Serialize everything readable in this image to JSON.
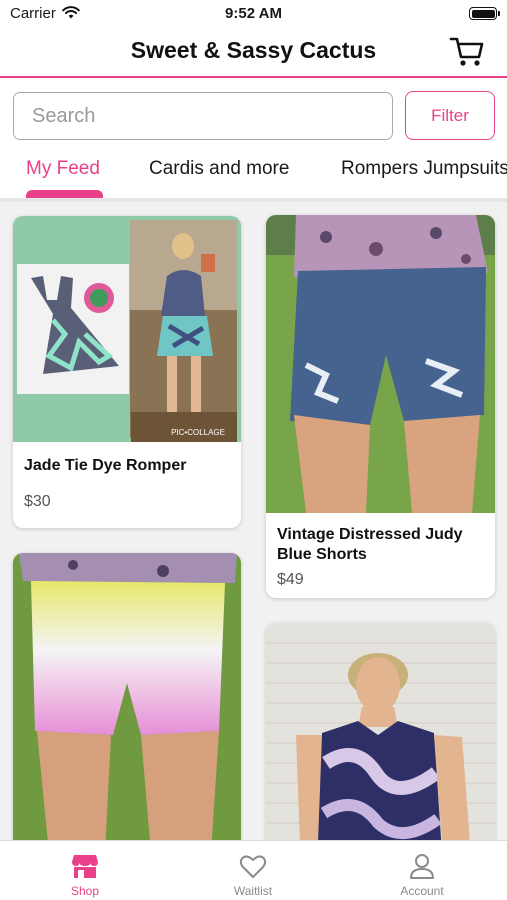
{
  "status_bar": {
    "carrier": "Carrier",
    "time": "9:52 AM"
  },
  "header": {
    "title": "Sweet & Sassy Cactus",
    "cart_icon": "cart-icon"
  },
  "search": {
    "placeholder": "Search",
    "value": ""
  },
  "filter_label": "Filter",
  "tabs": [
    {
      "label": "My Feed",
      "active": true
    },
    {
      "label": "Cardis and more",
      "active": false
    },
    {
      "label": "Rompers Jumpsuits",
      "active": false
    }
  ],
  "products": [
    {
      "title": "Jade Tie Dye Romper",
      "price": "$30",
      "image_watermark": "PIC•COLLAGE"
    },
    {
      "title": "Vintage Distressed Judy Blue Shorts",
      "price": "$49"
    },
    {
      "title": "",
      "price": ""
    },
    {
      "title": "",
      "price": ""
    }
  ],
  "bottom_nav": [
    {
      "label": "Shop",
      "icon": "shop-icon",
      "active": true
    },
    {
      "label": "Waitlist",
      "icon": "heart-icon",
      "active": false
    },
    {
      "label": "Account",
      "icon": "person-icon",
      "active": false
    }
  ],
  "colors": {
    "accent": "#e8418a",
    "tab_divider": "#e5e5e5",
    "muted_text": "#8a8a8a"
  }
}
